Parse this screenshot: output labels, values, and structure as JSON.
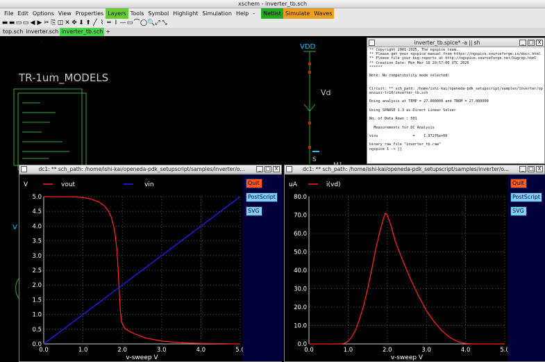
{
  "xschem": {
    "title": "xschem - inverter_tb.sch",
    "menu": [
      "File",
      "Edit",
      "Options",
      "View",
      "Properties",
      "Layers",
      "Tools",
      "Symbol",
      "Highlight",
      "Simulation",
      "Help"
    ],
    "menu_more": "-",
    "actions": [
      "Netlist",
      "Simulate",
      "Waves"
    ],
    "tabs": [
      "top.sch",
      "inverter.sch",
      "inverter_tb.sch"
    ],
    "tab_add": "+",
    "toolbar_icons": [
      "save-icon",
      "open-icon",
      "new-icon",
      "netlist-icon",
      "undo-icon",
      "redo-icon",
      "cut-icon",
      "copy-icon",
      "paste-icon",
      "delete-icon",
      "move-icon",
      "push-icon",
      "pop-icon",
      "wire-icon",
      "bus-icon",
      "line-icon",
      "rect-icon",
      "poly-icon",
      "arc-icon",
      "circle-icon",
      "text-icon",
      "zoom-icon",
      "fit-icon",
      "unfit-icon"
    ],
    "toolbar_glyphs": [
      "▬",
      "▬",
      "▭",
      "▭",
      "◀",
      "▶",
      "✂",
      "⎘",
      "◫",
      "✕",
      "✥",
      "⬇",
      "⬆",
      "╱",
      "⌇",
      "═",
      "I",
      "—",
      "▭",
      "⌒",
      "◯",
      "🔍",
      "⤢",
      "⤡"
    ]
  },
  "schematic": {
    "models_label": "TR-1um_MODELS",
    "vdd_label": "VDD",
    "vd_label": "Vd",
    "s_label": "S",
    "m1_label": "M1",
    "v_left_label": "V",
    "colors": {
      "net": "#00ccff",
      "wire": "#3aaa3a",
      "text": "#cccccc",
      "pin": "#b03010"
    }
  },
  "terminal": {
    "title": "inverter_tb.spice* -a || sh",
    "lines": [
      "** Copyright 2001-2025, The ngspice team.",
      "** Please get your ngspice manual from https://ngspice.sourceforge.io/docs.html",
      "** Please file your bug-reports at http://ngspice.sourceforge.net/bugrep.html",
      "** Creation Date: Mon Mar 16 20:57:00 UTC 2026",
      "******",
      "",
      "Note: No compatibility mode selected!",
      "",
      "",
      "Circuit: ** sch_path: /home/ishi-kai/openeda-pdk_setupscript/samples/inverter/op",
      "ensusi-tr10/inverter_tb.sch",
      "",
      "Doing analysis at TEMP = 27.000000 and TNOM = 27.000000",
      "",
      "Using SPARSE 1.3 as Direct Linear Solver",
      "",
      "No. of Data Rows : 501",
      "",
      "  Measurements for DC Analysis",
      "",
      "vinv                =    1.97276e+00",
      "",
      "binary raw file \"inverter_tb.raw\"",
      "ngspice 1 -> []"
    ]
  },
  "wave1": {
    "title": "dc1: ** sch_path: /home/ishi-kai/openeda-pdk_setupscript/samples/inverter/o...",
    "buttons": {
      "quit": "Quit",
      "postscript": "PostScript",
      "svg": "SVG"
    }
  },
  "wave2": {
    "title": "dc1: ** sch_path: /home/ishi-kai/openeda-pdk_setupscript/samples/inverter/o...",
    "buttons": {
      "quit": "Quit",
      "postscript": "PostScript",
      "svg": "SVG"
    }
  },
  "window_buttons": {
    "min": "_",
    "max": "□",
    "close": "X"
  },
  "chart_data": [
    {
      "type": "line",
      "title": "",
      "ylabel": "V",
      "xlabel": "v-sweep   V",
      "xlim": [
        0,
        5
      ],
      "ylim": [
        0,
        5
      ],
      "xticks": [
        "0.0",
        "1.0",
        "2.0",
        "3.0",
        "4.0",
        "5.0"
      ],
      "yticks": [
        "0.0",
        "0.5",
        "1.0",
        "1.5",
        "2.0",
        "2.5",
        "3.0",
        "3.5",
        "4.0",
        "4.5",
        "5.0"
      ],
      "grid": true,
      "legend": "top",
      "series": [
        {
          "name": "vout",
          "color": "#ff2020",
          "x": [
            0,
            0.8,
            1.0,
            1.2,
            1.4,
            1.55,
            1.65,
            1.72,
            1.78,
            1.82,
            1.86,
            1.89,
            1.92,
            1.95,
            1.98,
            2.05,
            2.15,
            2.3,
            2.6,
            3.0,
            3.5,
            4.0,
            4.5,
            5.0
          ],
          "values": [
            5.0,
            4.99,
            4.97,
            4.92,
            4.82,
            4.68,
            4.5,
            4.3,
            4.0,
            3.7,
            3.2,
            2.6,
            1.8,
            1.1,
            0.75,
            0.55,
            0.45,
            0.35,
            0.2,
            0.1,
            0.04,
            0.02,
            0.01,
            0.0
          ]
        },
        {
          "name": "vin",
          "color": "#2020ff",
          "x": [
            0,
            5
          ],
          "values": [
            0,
            5
          ]
        }
      ]
    },
    {
      "type": "line",
      "title": "",
      "ylabel": "uA",
      "xlabel": "v-sweep   V",
      "xlim": [
        0,
        5
      ],
      "ylim": [
        0,
        80
      ],
      "xticks": [
        "0.0",
        "1.0",
        "2.0",
        "3.0",
        "4.0",
        "5.0"
      ],
      "yticks": [
        "0.0",
        "10.0",
        "20.0",
        "30.0",
        "40.0",
        "50.0",
        "60.0",
        "70.0",
        "80.0"
      ],
      "grid": true,
      "legend": "top",
      "series": [
        {
          "name": "i(vd)",
          "color": "#ff2020",
          "x": [
            0,
            0.8,
            0.9,
            1.0,
            1.1,
            1.2,
            1.3,
            1.4,
            1.5,
            1.6,
            1.7,
            1.8,
            1.9,
            1.95,
            2.0,
            2.1,
            2.2,
            2.4,
            2.6,
            2.8,
            3.0,
            3.2,
            3.4,
            3.6,
            3.8,
            4.0,
            4.1,
            4.2,
            5.0
          ],
          "values": [
            0,
            0,
            0.3,
            1.5,
            4.0,
            8.0,
            14.0,
            21.0,
            30.0,
            40.0,
            51.0,
            60.0,
            68.0,
            71.0,
            70.0,
            64.0,
            56.0,
            45.0,
            35.0,
            26.0,
            18.0,
            12.0,
            7.0,
            3.5,
            1.2,
            0.3,
            0.1,
            0,
            0
          ]
        }
      ]
    }
  ]
}
